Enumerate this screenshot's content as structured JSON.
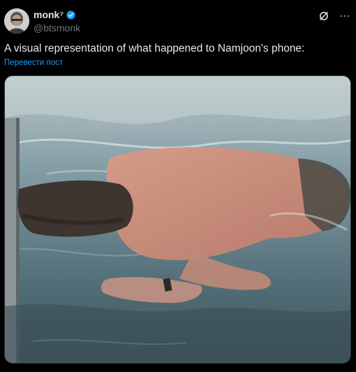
{
  "author": {
    "display_name": "monk⁷",
    "handle": "@btsmonk",
    "avatar_icon": "avatar-photo",
    "verified_icon": "verified-badge-icon",
    "verified_color": "#1d9bf0"
  },
  "header_actions": {
    "grok_icon": "grok-icon",
    "more_icon": "more-options-icon"
  },
  "tweet": {
    "text": "A visual representation of what happened to Namjoon's phone:",
    "translate_label": "Перевести пост"
  },
  "media": {
    "type": "video-thumbnail",
    "icon": "pool-video-still"
  },
  "colors": {
    "background": "#000000",
    "text": "#e7e9ea",
    "secondary_text": "#71767b",
    "link": "#1d9bf0"
  }
}
